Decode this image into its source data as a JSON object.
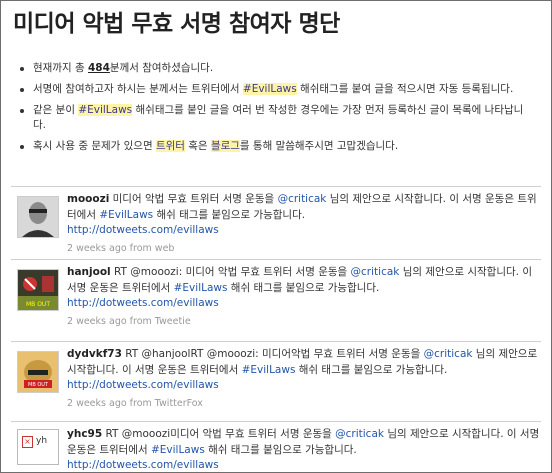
{
  "title": "미디어 악법 무효 서명 참여자 명단",
  "info": {
    "line1_pre": "현재까지 총 ",
    "count": "484",
    "line1_post": "분께서 참여하셨습니다.",
    "line2_pre": "서명에 참여하고자 하시는 분께서는 트위터에서 ",
    "hashtag": "#EvilLaws",
    "line2_post": " 해쉬태그를 붙여 글을 적으시면 자동 등록됩니다.",
    "line3_pre": "같은 분이 ",
    "line3_post": " 해쉬태그를 붙인 글을 여러 번 작성한 경우에는 가장 먼저 등록하신 글이 목록에 나타납니다.",
    "line4_pre": "혹시 사용 중 문제가 있으면 ",
    "twitter_link": "트위터",
    "line4_mid": " 혹은 ",
    "blog_link": "블로그",
    "line4_post": "를 통해 말씀해주시면 고맙겠습니다."
  },
  "tweets": [
    {
      "user": "mooozi",
      "pre": " 미디어 악법 무효 트위터 서명 운동을 ",
      "mention": "@criticak",
      "mid": " 님의 제안으로 시작합니다. 이 서명 운동은 트위터에서 ",
      "hashtag": "#EvilLaws",
      "post": " 해쉬 태그를 붙임으로 가능합니다.",
      "url": "http://dotweets.com/evillaws",
      "meta": "2 weeks ago from web"
    },
    {
      "user": "hanjool",
      "pre": " RT @mooozi: 미디어 악법 무효 트위터 서명 운동을 ",
      "mention": "@criticak",
      "mid": " 님의 제안으로 시작합니다. 이 서명 운동은 트위터에서 ",
      "hashtag": "#EvilLaws",
      "post": " 해쉬 태그를 붙임으로 가능합니다.",
      "url": "http://dotweets.com/evillaws",
      "meta": "2 weeks ago from Tweetie"
    },
    {
      "user": "dydvkf73",
      "pre": " RT @hanjoolRT @mooozi: 미디어악법 무효 트위터 서명 운동을 ",
      "mention": "@criticak",
      "mid": " 님의 제안으로 시작합니다. 이 서명 운동은 트위터에서 ",
      "hashtag": "#EvilLaws",
      "post": " 해쉬 태그를 붙임으로 가능합니다.",
      "url": "http://dotweets.com/evillaws",
      "meta": "2 weeks ago from TwitterFox"
    },
    {
      "user": "yhc95",
      "avatar_alt": "yh",
      "pre": " RT @mooozi미디어 악법 무효 트위터 서명 운동을 ",
      "mention": "@criticak",
      "mid": " 님의 제안으로 시작합니다. 이 서명 운동은 트위터에서 ",
      "hashtag": "#EvilLaws",
      "post": " 해쉬 태그를 붙임으로 가능합니다.",
      "url": "http://dotweets.com/evillaws",
      "meta": ""
    }
  ]
}
